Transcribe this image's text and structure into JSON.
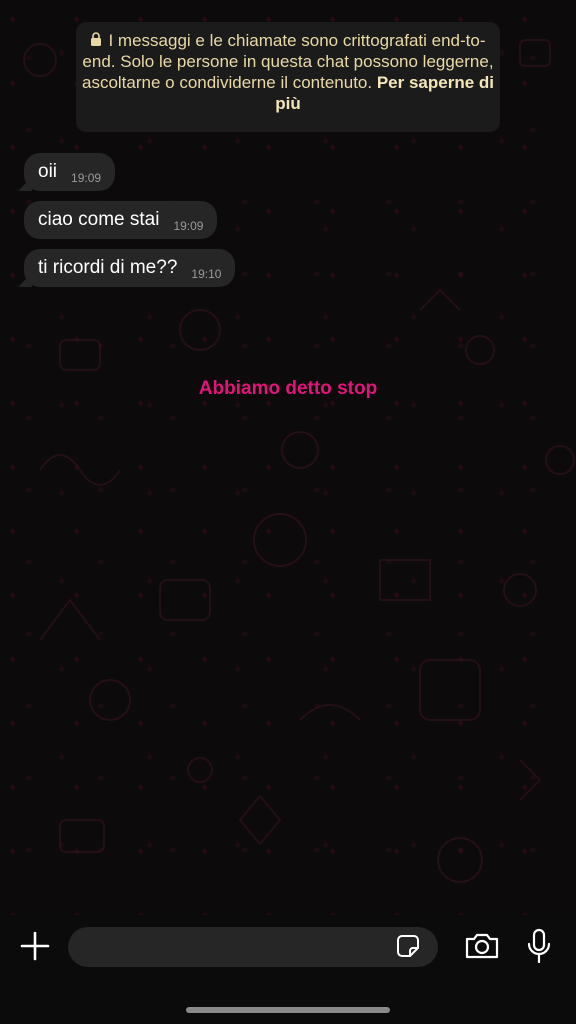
{
  "notice": {
    "text": "I messaggi e le chiamate sono crittografati end-to-end. Solo le persone in questa chat possono leggerne, ascoltarne o condividerne il contenuto. ",
    "link": "Per saperne di più",
    "icon": "lock-icon"
  },
  "messages": [
    {
      "text": "oii",
      "time": "19:09"
    },
    {
      "text": "ciao come stai",
      "time": "19:09"
    },
    {
      "text": "ti ricordi di me??",
      "time": "19:10"
    }
  ],
  "overlay_text": "Abbiamo detto stop",
  "composer": {
    "plus_icon": "plus-icon",
    "sticker_icon": "sticker-icon",
    "camera_icon": "camera-icon",
    "mic_icon": "microphone-icon"
  },
  "colors": {
    "overlay": "#e0157a",
    "notice_text": "#e9d9a6",
    "bubble": "#262626"
  }
}
